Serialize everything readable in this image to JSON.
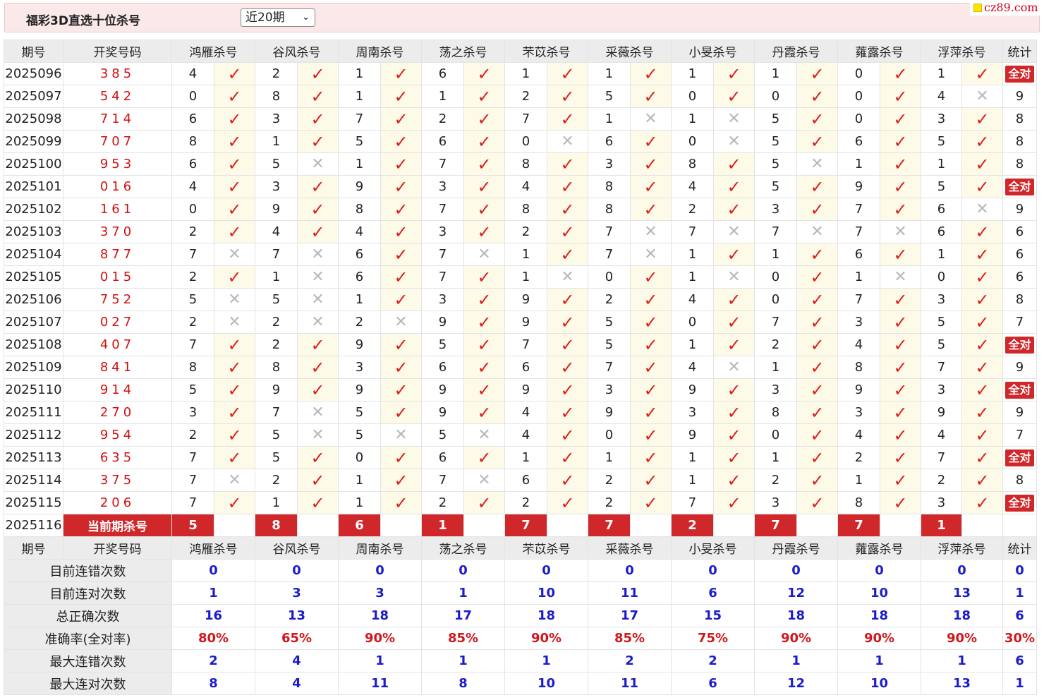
{
  "header": {
    "title": "福彩3D直选十位杀号",
    "range_selected": "近20期"
  },
  "logo": {
    "text": "cz89.com"
  },
  "table": {
    "col_issue": "期号",
    "col_draw": "开奖号码",
    "col_stat": "统计",
    "experts": [
      "鸿雁杀号",
      "谷风杀号",
      "周南杀号",
      "荡之杀号",
      "芣苡杀号",
      "采薇杀号",
      "小旻杀号",
      "丹霞杀号",
      "蕹露杀号",
      "浮萍杀号"
    ],
    "rows": [
      {
        "issue": "2025096",
        "draw": "385",
        "kills": [
          "4",
          "2",
          "1",
          "6",
          "1",
          "1",
          "1",
          "1",
          "0",
          "1"
        ],
        "hits": [
          1,
          1,
          1,
          1,
          1,
          1,
          1,
          1,
          1,
          1
        ],
        "stat": "全对"
      },
      {
        "issue": "2025097",
        "draw": "542",
        "kills": [
          "0",
          "8",
          "1",
          "1",
          "2",
          "5",
          "0",
          "0",
          "0",
          "4"
        ],
        "hits": [
          1,
          1,
          1,
          1,
          1,
          1,
          1,
          1,
          1,
          0
        ],
        "stat": "9"
      },
      {
        "issue": "2025098",
        "draw": "714",
        "kills": [
          "6",
          "3",
          "7",
          "2",
          "7",
          "1",
          "1",
          "5",
          "0",
          "3"
        ],
        "hits": [
          1,
          1,
          1,
          1,
          1,
          0,
          0,
          1,
          1,
          1
        ],
        "stat": "8"
      },
      {
        "issue": "2025099",
        "draw": "707",
        "kills": [
          "8",
          "1",
          "5",
          "6",
          "0",
          "6",
          "0",
          "5",
          "6",
          "5"
        ],
        "hits": [
          1,
          1,
          1,
          1,
          0,
          1,
          0,
          1,
          1,
          1
        ],
        "stat": "8"
      },
      {
        "issue": "2025100",
        "draw": "953",
        "kills": [
          "6",
          "5",
          "1",
          "7",
          "8",
          "3",
          "8",
          "5",
          "1",
          "1"
        ],
        "hits": [
          1,
          0,
          1,
          1,
          1,
          1,
          1,
          0,
          1,
          1
        ],
        "stat": "8"
      },
      {
        "issue": "2025101",
        "draw": "016",
        "kills": [
          "4",
          "3",
          "9",
          "3",
          "4",
          "8",
          "4",
          "5",
          "9",
          "5"
        ],
        "hits": [
          1,
          1,
          1,
          1,
          1,
          1,
          1,
          1,
          1,
          1
        ],
        "stat": "全对"
      },
      {
        "issue": "2025102",
        "draw": "161",
        "kills": [
          "0",
          "9",
          "8",
          "7",
          "8",
          "8",
          "2",
          "3",
          "7",
          "6"
        ],
        "hits": [
          1,
          1,
          1,
          1,
          1,
          1,
          1,
          1,
          1,
          0
        ],
        "stat": "9"
      },
      {
        "issue": "2025103",
        "draw": "370",
        "kills": [
          "2",
          "4",
          "4",
          "3",
          "2",
          "7",
          "7",
          "7",
          "7",
          "6"
        ],
        "hits": [
          1,
          1,
          1,
          1,
          1,
          0,
          0,
          0,
          0,
          1
        ],
        "stat": "6"
      },
      {
        "issue": "2025104",
        "draw": "877",
        "kills": [
          "7",
          "7",
          "6",
          "7",
          "1",
          "7",
          "1",
          "1",
          "6",
          "1"
        ],
        "hits": [
          0,
          0,
          1,
          0,
          1,
          0,
          1,
          1,
          1,
          1
        ],
        "stat": "6"
      },
      {
        "issue": "2025105",
        "draw": "015",
        "kills": [
          "2",
          "1",
          "6",
          "7",
          "1",
          "0",
          "1",
          "0",
          "1",
          "0"
        ],
        "hits": [
          1,
          0,
          1,
          1,
          0,
          1,
          0,
          1,
          0,
          1
        ],
        "stat": "6"
      },
      {
        "issue": "2025106",
        "draw": "752",
        "kills": [
          "5",
          "5",
          "1",
          "3",
          "9",
          "2",
          "4",
          "0",
          "7",
          "3"
        ],
        "hits": [
          0,
          0,
          1,
          1,
          1,
          1,
          1,
          1,
          1,
          1
        ],
        "stat": "8"
      },
      {
        "issue": "2025107",
        "draw": "027",
        "kills": [
          "2",
          "2",
          "2",
          "9",
          "9",
          "5",
          "0",
          "7",
          "3",
          "5"
        ],
        "hits": [
          0,
          0,
          0,
          1,
          1,
          1,
          1,
          1,
          1,
          1
        ],
        "stat": "7"
      },
      {
        "issue": "2025108",
        "draw": "407",
        "kills": [
          "7",
          "2",
          "9",
          "5",
          "7",
          "5",
          "1",
          "2",
          "4",
          "5"
        ],
        "hits": [
          1,
          1,
          1,
          1,
          1,
          1,
          1,
          1,
          1,
          1
        ],
        "stat": "全对"
      },
      {
        "issue": "2025109",
        "draw": "841",
        "kills": [
          "8",
          "8",
          "3",
          "6",
          "6",
          "7",
          "4",
          "1",
          "8",
          "7"
        ],
        "hits": [
          1,
          1,
          1,
          1,
          1,
          1,
          0,
          1,
          1,
          1
        ],
        "stat": "9"
      },
      {
        "issue": "2025110",
        "draw": "914",
        "kills": [
          "5",
          "9",
          "9",
          "9",
          "9",
          "3",
          "9",
          "3",
          "9",
          "3"
        ],
        "hits": [
          1,
          1,
          1,
          1,
          1,
          1,
          1,
          1,
          1,
          1
        ],
        "stat": "全对"
      },
      {
        "issue": "2025111",
        "draw": "270",
        "kills": [
          "3",
          "7",
          "5",
          "9",
          "4",
          "9",
          "3",
          "8",
          "3",
          "9"
        ],
        "hits": [
          1,
          0,
          1,
          1,
          1,
          1,
          1,
          1,
          1,
          1
        ],
        "stat": "9"
      },
      {
        "issue": "2025112",
        "draw": "954",
        "kills": [
          "2",
          "5",
          "5",
          "5",
          "4",
          "0",
          "9",
          "0",
          "4",
          "4"
        ],
        "hits": [
          1,
          0,
          0,
          0,
          1,
          1,
          1,
          1,
          1,
          1
        ],
        "stat": "7"
      },
      {
        "issue": "2025113",
        "draw": "635",
        "kills": [
          "7",
          "5",
          "0",
          "6",
          "1",
          "1",
          "1",
          "1",
          "2",
          "7"
        ],
        "hits": [
          1,
          1,
          1,
          1,
          1,
          1,
          1,
          1,
          1,
          1
        ],
        "stat": "全对"
      },
      {
        "issue": "2025114",
        "draw": "375",
        "kills": [
          "7",
          "2",
          "1",
          "7",
          "6",
          "2",
          "1",
          "2",
          "1",
          "2"
        ],
        "hits": [
          0,
          1,
          1,
          0,
          1,
          1,
          1,
          1,
          1,
          1
        ],
        "stat": "8"
      },
      {
        "issue": "2025115",
        "draw": "206",
        "kills": [
          "7",
          "1",
          "1",
          "2",
          "2",
          "2",
          "7",
          "3",
          "8",
          "3"
        ],
        "hits": [
          1,
          1,
          1,
          1,
          1,
          1,
          1,
          1,
          1,
          1
        ],
        "stat": "全对"
      }
    ],
    "current": {
      "issue": "2025116",
      "label": "当前期杀号",
      "kills": [
        "5",
        "8",
        "6",
        "1",
        "7",
        "7",
        "2",
        "7",
        "7",
        "1"
      ]
    }
  },
  "summary": {
    "metrics": [
      {
        "label": "目前连错次数",
        "values": [
          "0",
          "0",
          "0",
          "0",
          "0",
          "0",
          "0",
          "0",
          "0",
          "0"
        ],
        "stat": "0",
        "color": "blue"
      },
      {
        "label": "目前连对次数",
        "values": [
          "1",
          "3",
          "3",
          "1",
          "10",
          "11",
          "6",
          "12",
          "10",
          "13"
        ],
        "stat": "1",
        "color": "blue"
      },
      {
        "label": "总正确次数",
        "values": [
          "16",
          "13",
          "18",
          "17",
          "18",
          "17",
          "15",
          "18",
          "18",
          "18"
        ],
        "stat": "6",
        "color": "blue"
      },
      {
        "label": "准确率(全对率)",
        "values": [
          "80%",
          "65%",
          "90%",
          "85%",
          "90%",
          "85%",
          "75%",
          "90%",
          "90%",
          "90%"
        ],
        "stat": "30%",
        "color": "red"
      },
      {
        "label": "最大连错次数",
        "values": [
          "2",
          "4",
          "1",
          "1",
          "1",
          "2",
          "2",
          "1",
          "1",
          "1"
        ],
        "stat": "6",
        "color": "blue"
      },
      {
        "label": "最大连对次数",
        "values": [
          "8",
          "4",
          "11",
          "8",
          "10",
          "11",
          "6",
          "12",
          "10",
          "13"
        ],
        "stat": "1",
        "color": "blue"
      }
    ]
  },
  "icons": {
    "hit": "check-icon",
    "miss": "cross-icon"
  },
  "colors": {
    "hit": "#dc1f1f",
    "miss": "#b8b8b8",
    "badge": "#d0282a",
    "metric_blue": "#1c1ccc",
    "metric_red": "#d0171b"
  }
}
